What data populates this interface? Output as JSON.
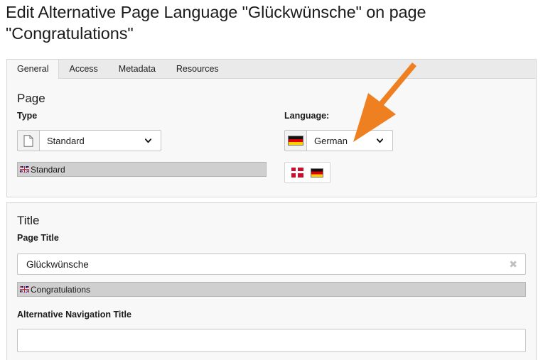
{
  "page_heading": "Edit Alternative Page Language \"Glückwünsche\" on page \"Congratulations\"",
  "tabs": [
    {
      "label": "General",
      "active": true
    },
    {
      "label": "Access",
      "active": false
    },
    {
      "label": "Metadata",
      "active": false
    },
    {
      "label": "Resources",
      "active": false
    }
  ],
  "page_section": {
    "heading": "Page",
    "type": {
      "label": "Type",
      "icon": "document-icon",
      "value": "Standard",
      "caret": "chevron-down-icon",
      "default_hint": {
        "flag": "gb-flag-icon",
        "text": "Standard"
      }
    },
    "language": {
      "label": "Language:",
      "icon": "de-flag-icon",
      "value": "German",
      "caret": "chevron-down-icon",
      "flag_chooser": [
        {
          "name": "dk-flag-icon"
        },
        {
          "name": "de-flag-icon"
        }
      ]
    }
  },
  "title_section": {
    "heading": "Title",
    "page_title": {
      "label": "Page Title",
      "value": "Glückwünsche",
      "placeholder": "",
      "clear_icon": "clear-x-icon",
      "default_hint": {
        "flag": "gb-flag-icon",
        "text": "Congratulations"
      }
    },
    "alternative_navigation_title": {
      "label": "Alternative Navigation Title",
      "value": "",
      "placeholder": ""
    }
  },
  "annotation": {
    "type": "arrow",
    "color": "#ef8022",
    "points_to": "language-select"
  },
  "colors": {
    "panel_bg": "#f8f8f8",
    "panel_border": "#d7d7d7",
    "tabbar_bg": "#eaeaea",
    "hint_bar_bg": "#cfcfcf",
    "accent_orange": "#ef8022"
  }
}
